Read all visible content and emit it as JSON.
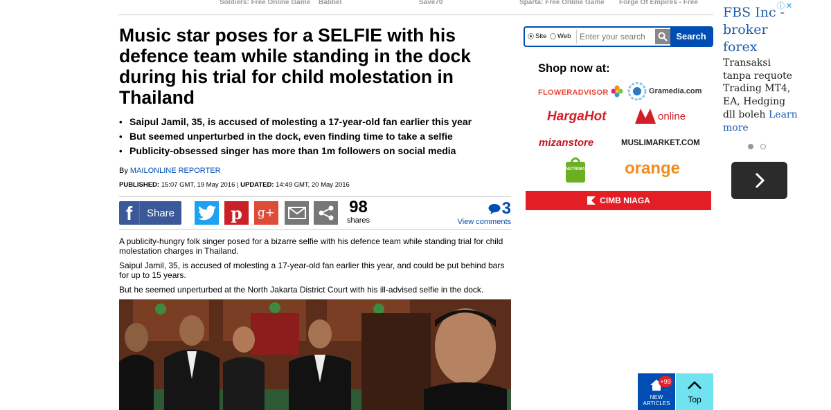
{
  "top_links": [
    "Soldiers: Free Online Game",
    "Babbel",
    "Save70",
    "Sparta: Free Online Game",
    "Forge Of Empires - Free"
  ],
  "article": {
    "headline": "Music star poses for a SELFIE with his defence team while standing in the dock during his trial for child molestation in Thailand",
    "bullets": [
      "Saipul Jamil, 35, is accused of molesting a 17-year-old fan earlier this year",
      "But seemed unperturbed in the dock, even finding time to take a selfie",
      "Publicity-obsessed singer has more than 1m followers on social media"
    ],
    "byline_prefix": "By",
    "author": "MAILONLINE REPORTER",
    "published_label": "PUBLISHED:",
    "published_value": "15:07 GMT, 19 May 2016",
    "separator": "|",
    "updated_label": "UPDATED:",
    "updated_value": "14:49 GMT, 20 May 2016",
    "paragraphs": [
      "A publicity-hungry folk singer posed for a bizarre selfie with his defence team while standing trial for child molestation charges in Thailand.",
      "Saipul Jamil, 35, is accused of molesting a 17-year-old fan earlier this year, and could be put behind bars for up to 15 years.",
      "But he seemed unperturbed at the North Jakarta District Court with his ill-advised selfie in the dock."
    ]
  },
  "share": {
    "facebook_label": "Share",
    "share_count": "98",
    "share_count_label": "shares",
    "comment_count": "3",
    "view_comments": "View comments"
  },
  "search": {
    "option_site": "Site",
    "option_web": "Web",
    "selected": "Site",
    "placeholder": "Enter your search",
    "button": "Search"
  },
  "shop": {
    "title": "Shop now at:",
    "stores": [
      "FLOWERADVISOR",
      "Gramedia.com",
      "HargaHot",
      "online",
      "mizanstore",
      "MUSLIMARKET.COM",
      "NUTRIMART",
      "orange"
    ],
    "banner": "CIMB NIAGA"
  },
  "ad": {
    "title": "FBS Inc - broker forex",
    "body": "Transaksi tanpa requote Trading MT4, EA, Hedging dll boleh",
    "learn_more": "Learn more",
    "info_icon": "info-icon",
    "close_icon": "close-icon"
  },
  "floating": {
    "new_articles_badge": "+99",
    "new_articles_label": "NEW ARTICLES",
    "top_label": "Top"
  },
  "colors": {
    "brand_blue": "#004db3",
    "facebook": "#3b5998",
    "twitter": "#1da1f2",
    "pinterest": "#cb2027",
    "google_plus": "#dd4b39",
    "cimb_red": "#e31e25",
    "top_button": "#6fe3f0"
  }
}
